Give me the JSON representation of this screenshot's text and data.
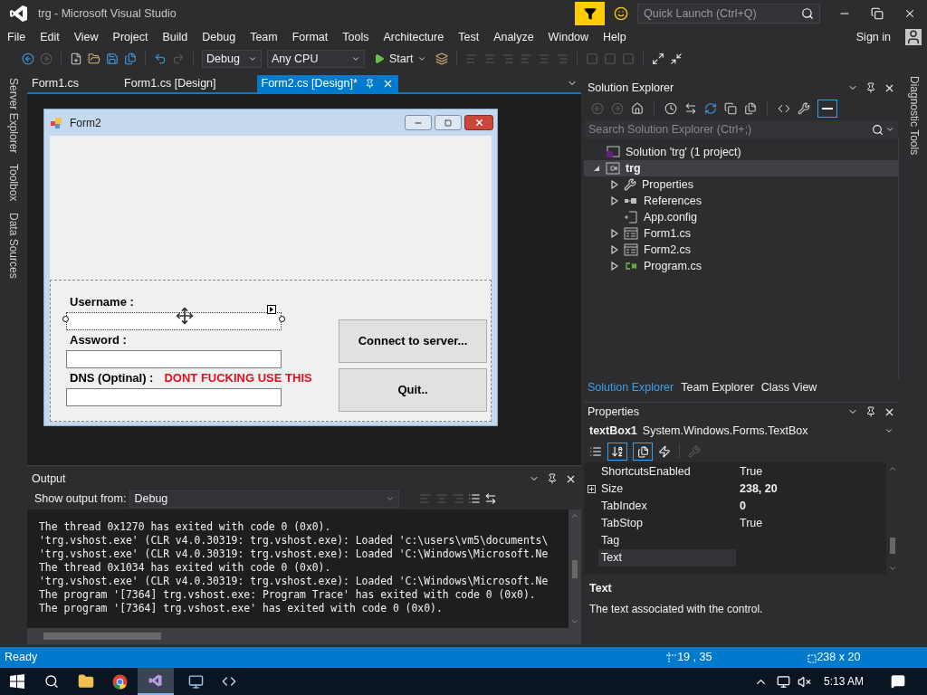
{
  "window": {
    "title": "trg - Microsoft Visual Studio"
  },
  "quick_launch": {
    "placeholder": "Quick Launch (Ctrl+Q)"
  },
  "menu": [
    "File",
    "Edit",
    "View",
    "Project",
    "Build",
    "Debug",
    "Team",
    "Format",
    "Tools",
    "Architecture",
    "Test",
    "Analyze",
    "Window",
    "Help"
  ],
  "sign_in": "Sign in",
  "toolbar": {
    "configuration": "Debug",
    "platform": "Any CPU",
    "start": "Start"
  },
  "left_tabs": [
    "Server Explorer",
    "Toolbox",
    "Data Sources"
  ],
  "right_tabs": [
    "Diagnostic Tools"
  ],
  "doc_tabs": [
    {
      "label": "Form1.cs",
      "selected": false
    },
    {
      "label": "Form1.cs [Design]",
      "selected": false
    },
    {
      "label": "Form2.cs [Design]*",
      "selected": true
    }
  ],
  "form": {
    "title": "Form2",
    "fields": [
      {
        "label": "Username :",
        "selected": true
      },
      {
        "label": "Assword :",
        "selected": false
      },
      {
        "label": "DNS (Optinal) :",
        "note": "DONT FUCKING USE THIS",
        "selected": false
      }
    ],
    "buttons": [
      "Connect to server...",
      "Quit.."
    ]
  },
  "output": {
    "title": "Output",
    "source_label": "Show output from:",
    "source": "Debug",
    "lines": [
      "The thread 0x1270 has exited with code 0 (0x0).",
      "'trg.vshost.exe' (CLR v4.0.30319: trg.vshost.exe): Loaded 'c:\\users\\vm5\\documents\\",
      "'trg.vshost.exe' (CLR v4.0.30319: trg.vshost.exe): Loaded 'C:\\Windows\\Microsoft.Ne",
      "The thread 0x1034 has exited with code 0 (0x0).",
      "'trg.vshost.exe' (CLR v4.0.30319: trg.vshost.exe): Loaded 'C:\\Windows\\Microsoft.Ne",
      "The program '[7364] trg.vshost.exe: Program Trace' has exited with code 0 (0x0).",
      "The program '[7364] trg.vshost.exe' has exited with code 0 (0x0)."
    ]
  },
  "solution_explorer": {
    "title": "Solution Explorer",
    "search_placeholder": "Search Solution Explorer (Ctrl+;)",
    "tree": [
      {
        "label": "Solution 'trg' (1 project)",
        "kind": "solution",
        "expandable": false,
        "selected": false
      },
      {
        "label": "trg",
        "kind": "project",
        "expandable": true,
        "expanded": true,
        "selected": true,
        "children": [
          {
            "label": "Properties",
            "kind": "properties",
            "expandable": true,
            "expanded": false,
            "selected": false
          },
          {
            "label": "References",
            "kind": "references",
            "expandable": true,
            "expanded": false,
            "selected": false
          },
          {
            "label": "App.config",
            "kind": "config",
            "expandable": false,
            "selected": false
          },
          {
            "label": "Form1.cs",
            "kind": "form",
            "expandable": true,
            "expanded": false,
            "selected": false
          },
          {
            "label": "Form2.cs",
            "kind": "form",
            "expandable": true,
            "expanded": false,
            "selected": false
          },
          {
            "label": "Program.cs",
            "kind": "csharp",
            "expandable": true,
            "expanded": false,
            "selected": false
          }
        ]
      }
    ],
    "tabs": [
      {
        "label": "Solution Explorer",
        "selected": true
      },
      {
        "label": "Team Explorer",
        "selected": false
      },
      {
        "label": "Class View",
        "selected": false
      }
    ]
  },
  "properties": {
    "title": "Properties",
    "object_name": "textBox1",
    "object_type": "System.Windows.Forms.TextBox",
    "rows": [
      {
        "name": "ShortcutsEnabled",
        "value": "True",
        "modified": false,
        "expandable": false,
        "selected": false
      },
      {
        "name": "Size",
        "value": "238, 20",
        "modified": true,
        "expandable": true,
        "selected": false
      },
      {
        "name": "TabIndex",
        "value": "0",
        "modified": true,
        "expandable": false,
        "selected": false
      },
      {
        "name": "TabStop",
        "value": "True",
        "modified": false,
        "expandable": false,
        "selected": false
      },
      {
        "name": "Tag",
        "expandable": false,
        "selected": false
      },
      {
        "name": "Text",
        "expandable": false,
        "selected": true
      }
    ],
    "description_title": "Text",
    "description": "The text associated with the control."
  },
  "status_bar": {
    "text": "Ready",
    "location": "19 , 35",
    "size": "238 x 20"
  },
  "taskbar": {
    "time": "5:13 AM"
  }
}
